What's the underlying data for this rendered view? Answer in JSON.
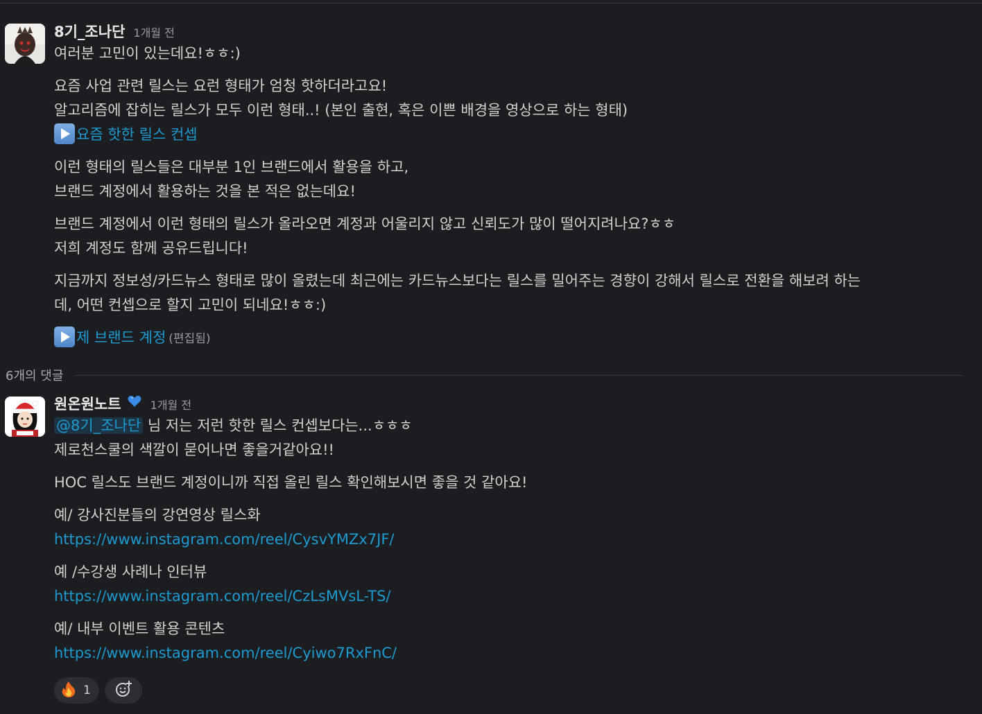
{
  "post": {
    "author": "8기_조나단",
    "timestamp": "1개월 전",
    "paragraphs": [
      [
        "여러분 고민이 있는데요!ㅎㅎ:)"
      ],
      [
        "요즘 사업 관련 릴스는 요런 형태가 엄청 핫하더라고요!",
        "알고리즘에 잡히는 릴스가 모두 이런 형태..! (본인 출현, 혹은 이쁜 배경을 영상으로 하는 형태)"
      ],
      [
        "이런 형태의 릴스들은 대부분 1인 브랜드에서 활용을 하고,",
        "브랜드 계정에서 활용하는 것을 본 적은 없는데요!"
      ],
      [
        "브랜드 계정에서 이런 형태의 릴스가 올라오면 계정과 어울리지 않고 신뢰도가 많이 떨어지려나요?ㅎㅎ",
        "저희 계정도 함께 공유드립니다!"
      ],
      [
        "지금까지 정보성/카드뉴스 형태로 많이 올렸는데 최근에는 카드뉴스보다는 릴스를 밀어주는 경향이 강해서 릴스로 전환을 해보려 하는",
        "데, 어떤 컨셉으로 할지 고민이 되네요!ㅎㅎ:)"
      ]
    ],
    "link1": "요즘 핫한 릴스 컨셉",
    "link2": "제 브랜드 계정",
    "edited": "(편집됨)",
    "play_icon": "play-button-icon"
  },
  "replies_label": "6개의 댓글",
  "reply": {
    "author": "원온원노트",
    "badge_icon": "blue-heart-icon",
    "timestamp": "1개월 전",
    "mention": "@8기_조나단",
    "line1_rest": " 님 저는 저런 핫한 릴스 컨셉보다는...ㅎㅎㅎ",
    "line2": "제로천스쿨의 색깔이 묻어나면 좋을거같아요!!",
    "line3": "HOC 릴스도 브랜드 계정이니까 직접 올린 릴스 확인해보시면 좋을 것 같아요!",
    "examples": [
      {
        "label": "예/ 강사진분들의 강연영상 릴스화",
        "url": "https://www.instagram.com/reel/CysvYMZx7JF/"
      },
      {
        "label": "예 /수강생 사례나 인터뷰",
        "url": "https://www.instagram.com/reel/CzLsMVsL-TS/"
      },
      {
        "label": "예/ 내부 이벤트 활용 콘텐츠",
        "url": "https://www.instagram.com/reel/Cyiwo7RxFnC/"
      }
    ]
  },
  "reactions": [
    {
      "emoji": "🔥",
      "icon": "fire-emoji-icon",
      "count": "1"
    }
  ],
  "add_reaction_icon": "add-reaction-icon",
  "colors": {
    "background": "#1b1d21",
    "link": "#1d9bd1",
    "text": "#d1d2d3",
    "muted": "#9a9b9e"
  }
}
